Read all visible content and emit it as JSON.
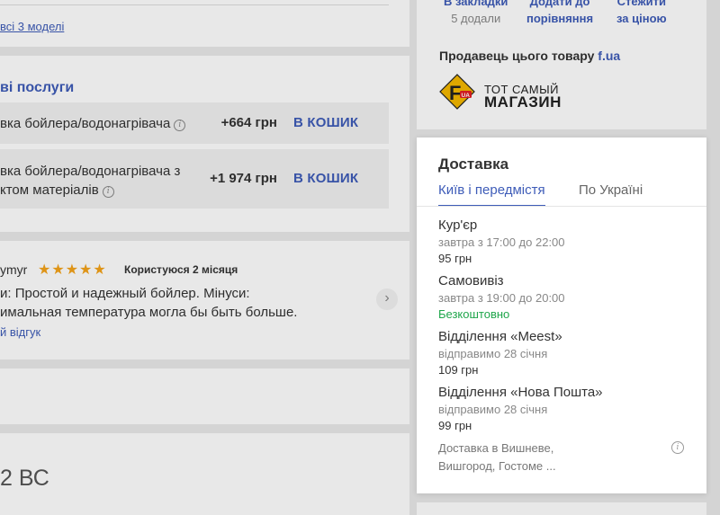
{
  "models": {
    "link": "всі 3 моделі"
  },
  "services": {
    "title": "ві послуги",
    "rows": [
      {
        "name": "вка бойлера/водонагрівача",
        "price": "+664 грн",
        "cart": "В КОШИК"
      },
      {
        "name_line1": "вка бойлера/водонагрівача з",
        "name_line2": "ктом матеріалів",
        "price": "+1 974 грн",
        "cart": "В КОШИК"
      }
    ]
  },
  "review": {
    "author": "ymyr",
    "stars": "★★★★★",
    "usage": "Користуюся 2 місяця",
    "line1": "и: Простой и надежный бойлер. Мінуси:",
    "line2": "имальная температура могла бы быть больше.",
    "link": "й відгук",
    "next_icon": "chevron-right"
  },
  "bottom": {
    "heading": "2 ВС"
  },
  "actions": {
    "bookmark": "В закладки",
    "bookmark_count": "5 додали",
    "compare_line1": "Додати до",
    "compare_line2": "порівняння",
    "price_line1": "Стежити",
    "price_line2": "за ціною"
  },
  "seller": {
    "label": "Продавець цього товару",
    "link": "f.ua",
    "logo_line1": "ТОТ САМЫЙ",
    "logo_line2": "МАГАЗИН",
    "logo_badge": "UA",
    "logo_color": "#f5b800"
  },
  "delivery": {
    "title": "Доставка",
    "tabs": [
      "Київ і передмістя",
      "По Україні"
    ],
    "methods": [
      {
        "name": "Кур'єр",
        "time": "завтра з 17:00 до 22:00",
        "price": "95 грн"
      },
      {
        "name": "Самовивіз",
        "time": "завтра з 19:00 до 20:00",
        "price": "Безкоштовно"
      },
      {
        "name": "Відділення «Meest»",
        "time": "відправимо 28 січня",
        "price": "109 грн"
      },
      {
        "name": "Відділення «Нова Пошта»",
        "time": "відправимо 28 січня",
        "price": "99 грн"
      }
    ],
    "note_line1": "Доставка в Вишневе,",
    "note_line2": "Вишгород, Гостоме ..."
  },
  "colors": {
    "accent": "#3e5cb8",
    "free": "#1fa64b",
    "stars": "#f5a31a"
  }
}
